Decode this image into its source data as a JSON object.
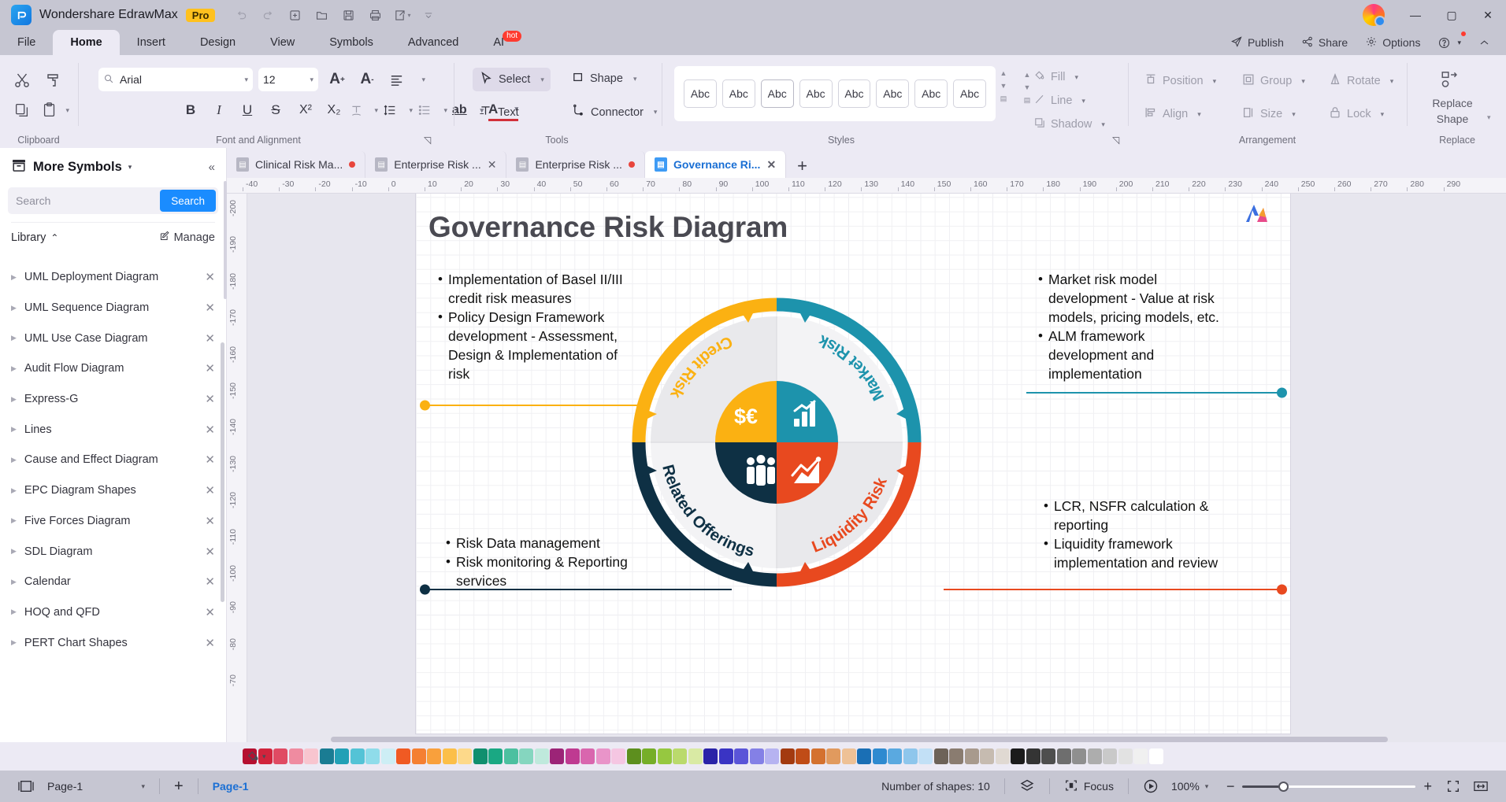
{
  "titlebar": {
    "app_name": "Wondershare EdrawMax",
    "pro_badge": "Pro",
    "quick_actions": [
      {
        "name": "undo-icon",
        "glyph": "↺"
      },
      {
        "name": "redo-icon",
        "glyph": "↻"
      },
      {
        "name": "new-icon",
        "glyph": "⊞"
      },
      {
        "name": "open-icon",
        "glyph": "🗁"
      },
      {
        "name": "save-icon",
        "glyph": "🖫"
      },
      {
        "name": "print-icon",
        "glyph": "🖨"
      },
      {
        "name": "export-icon",
        "glyph": "⎘"
      },
      {
        "name": "more-icon",
        "glyph": "⌄"
      }
    ],
    "window_buttons": {
      "minimize": "—",
      "maximize": "▢",
      "close": "✕"
    }
  },
  "menubar": {
    "items": [
      {
        "label": "File",
        "active": false
      },
      {
        "label": "Home",
        "active": true
      },
      {
        "label": "Insert",
        "active": false
      },
      {
        "label": "Design",
        "active": false
      },
      {
        "label": "View",
        "active": false
      },
      {
        "label": "Symbols",
        "active": false
      },
      {
        "label": "Advanced",
        "active": false
      },
      {
        "label": "AI",
        "active": false,
        "badge": "hot"
      }
    ],
    "right_actions": [
      {
        "label": "Publish",
        "icon": "publish-icon"
      },
      {
        "label": "Share",
        "icon": "share-icon"
      },
      {
        "label": "Options",
        "icon": "gear-icon"
      }
    ],
    "help_icon": "help-icon",
    "collapse_icon": "chevron-up-icon"
  },
  "ribbon": {
    "groups": [
      {
        "label": "Clipboard"
      },
      {
        "label": "Font and Alignment"
      },
      {
        "label": "Tools"
      },
      {
        "label": "Styles"
      },
      {
        "label": "Arrangement"
      },
      {
        "label": "Replace"
      }
    ],
    "clipboard": {
      "cut": "cut-icon",
      "format_painter": "format-painter-icon",
      "copy": "copy-icon",
      "paste": "paste-icon"
    },
    "font": {
      "family_value": "Arial",
      "size_value": "12",
      "grow_label": "A+",
      "shrink_label": "A-",
      "bold": "B",
      "italic": "I",
      "underline": "U",
      "strike": "S",
      "superscript": "X²",
      "subscript": "X₂"
    },
    "tools": {
      "select": "Select",
      "shape": "Shape",
      "text": "Text",
      "connector": "Connector"
    },
    "styles": {
      "swatch_label": "Abc",
      "swatch_count": 8
    },
    "shape_props": [
      {
        "label": "Fill",
        "icon": "fill-icon"
      },
      {
        "label": "Line",
        "icon": "line-icon"
      },
      {
        "label": "Shadow",
        "icon": "shadow-icon"
      }
    ],
    "arrangement": [
      {
        "label": "Position",
        "icon": "position-icon"
      },
      {
        "label": "Group",
        "icon": "group-icon"
      },
      {
        "label": "Rotate",
        "icon": "rotate-icon"
      },
      {
        "label": "Align",
        "icon": "align-icon"
      },
      {
        "label": "Size",
        "icon": "size-icon"
      },
      {
        "label": "Lock",
        "icon": "lock-icon"
      }
    ],
    "replace": {
      "label_line1": "Replace",
      "label_line2": "Shape",
      "icon": "replace-shape-icon"
    }
  },
  "left_panel": {
    "title": "More Symbols",
    "search_placeholder": "Search",
    "search_value": "",
    "search_button": "Search",
    "library_label": "Library",
    "manage_label": "Manage",
    "items": [
      {
        "label": "UML Deployment Diagram"
      },
      {
        "label": "UML Sequence Diagram"
      },
      {
        "label": "UML Use Case Diagram"
      },
      {
        "label": "Audit Flow Diagram"
      },
      {
        "label": "Express-G"
      },
      {
        "label": "Lines"
      },
      {
        "label": "Cause and Effect Diagram"
      },
      {
        "label": "EPC Diagram Shapes"
      },
      {
        "label": "Five Forces Diagram"
      },
      {
        "label": "SDL Diagram"
      },
      {
        "label": "Calendar"
      },
      {
        "label": "HOQ and QFD"
      },
      {
        "label": "PERT Chart Shapes"
      }
    ]
  },
  "tabs": {
    "documents": [
      {
        "label": "Clinical Risk Ma...",
        "active": false,
        "modified": true
      },
      {
        "label": "Enterprise Risk ...",
        "active": false,
        "modified": false
      },
      {
        "label": "Enterprise Risk ...",
        "active": false,
        "modified": true
      },
      {
        "label": "Governance Ri...",
        "active": true,
        "modified": false
      }
    ],
    "add_label": "+"
  },
  "rulers": {
    "horizontal_ticks": [
      "-40",
      "-30",
      "-20",
      "-10",
      "0",
      "10",
      "20",
      "30",
      "40",
      "50",
      "60",
      "70",
      "80",
      "90",
      "100",
      "110",
      "120",
      "130",
      "140",
      "150",
      "160",
      "170",
      "180",
      "190",
      "200",
      "210",
      "220",
      "230",
      "240",
      "250",
      "260",
      "270",
      "280",
      "290"
    ],
    "vertical_ticks": [
      "-200",
      "-190",
      "-180",
      "-170",
      "-160",
      "-150",
      "-140",
      "-130",
      "-120",
      "-110",
      "-100",
      "-90",
      "-80",
      "-70"
    ]
  },
  "diagram": {
    "title": "Governance Risk Diagram",
    "quadrants": [
      {
        "name": "Credit Risk",
        "color": "#FBB112",
        "icon": "currency-icon",
        "position": "top-left"
      },
      {
        "name": "Market Risk",
        "color": "#1D93AC",
        "icon": "bar-chart-icon",
        "position": "top-right"
      },
      {
        "name": "Liquidity Risk",
        "color": "#E8491F",
        "icon": "line-chart-icon",
        "position": "bottom-right"
      },
      {
        "name": "Related Offerings",
        "color": "#0E3044",
        "icon": "people-icon",
        "position": "bottom-left"
      }
    ],
    "callouts": [
      {
        "id": "credit-risk-callout",
        "color": "#FBB112",
        "bullets": [
          "Implementation of Basel II/III credit risk measures",
          "Policy Design Framework development - Assessment, Design & Implementation of risk"
        ]
      },
      {
        "id": "market-risk-callout",
        "color": "#1D93AC",
        "bullets": [
          "Market risk model development - Value at risk models, pricing models, etc.",
          "ALM framework development and implementation"
        ]
      },
      {
        "id": "related-offerings-callout",
        "color": "#0E3044",
        "bullets": [
          "Risk Data management",
          "Risk monitoring & Reporting services"
        ]
      },
      {
        "id": "liquidity-risk-callout",
        "color": "#E8491F",
        "bullets": [
          "LCR, NSFR calculation & reporting",
          "Liquidity framework implementation and review"
        ]
      }
    ]
  },
  "statusbar": {
    "page_switch_icon": "page-layout-icon",
    "page_selector_value": "Page-1",
    "add_page_label": "+",
    "active_page_label": "Page-1",
    "shape_count_label": "Number of shapes: 10",
    "layers_icon": "layers-icon",
    "focus_label": "Focus",
    "presentation_icon": "play-icon",
    "zoom_value": "100%",
    "zoom_minus": "−",
    "zoom_plus": "+",
    "fit_page_icon": "fit-page-icon",
    "fit_width_icon": "fit-width-icon"
  },
  "palette": {
    "fill_icon": "fill-bucket-icon",
    "colors": [
      "#b51030",
      "#d1243c",
      "#e04a63",
      "#ef8ba0",
      "#f8c5cf",
      "#1a7c93",
      "#22a0b6",
      "#54c3d6",
      "#8fdcea",
      "#cdeef5",
      "#f05a23",
      "#f57f32",
      "#f9a03c",
      "#fcbf49",
      "#fdd98a",
      "#0f8f6e",
      "#1aa883",
      "#4cc0a0",
      "#85d6bf",
      "#bfe9dc",
      "#9c2477",
      "#bf3a91",
      "#d966ae",
      "#e994c9",
      "#f5c6e2",
      "#5d8f1e",
      "#76ae28",
      "#96c840",
      "#bada6c",
      "#d9eaa4",
      "#2a23a8",
      "#3a34c4",
      "#5a54d8",
      "#8480e6",
      "#b6b3f1",
      "#a33a10",
      "#c04c17",
      "#d4712f",
      "#e19a5e",
      "#eec196",
      "#1a6fb5",
      "#2e8ad0",
      "#5aa9e0",
      "#8ec6ec",
      "#c2e0f6",
      "#6d6258",
      "#8a7c70",
      "#a89a8d",
      "#c6bbb0",
      "#e0d9d2",
      "#1b1b1b",
      "#343434",
      "#4e4e4e",
      "#6e6e6e",
      "#8f8f8f",
      "#adadad",
      "#c9c9c9",
      "#e2e2e2",
      "#f0f0f0",
      "#ffffff"
    ]
  }
}
